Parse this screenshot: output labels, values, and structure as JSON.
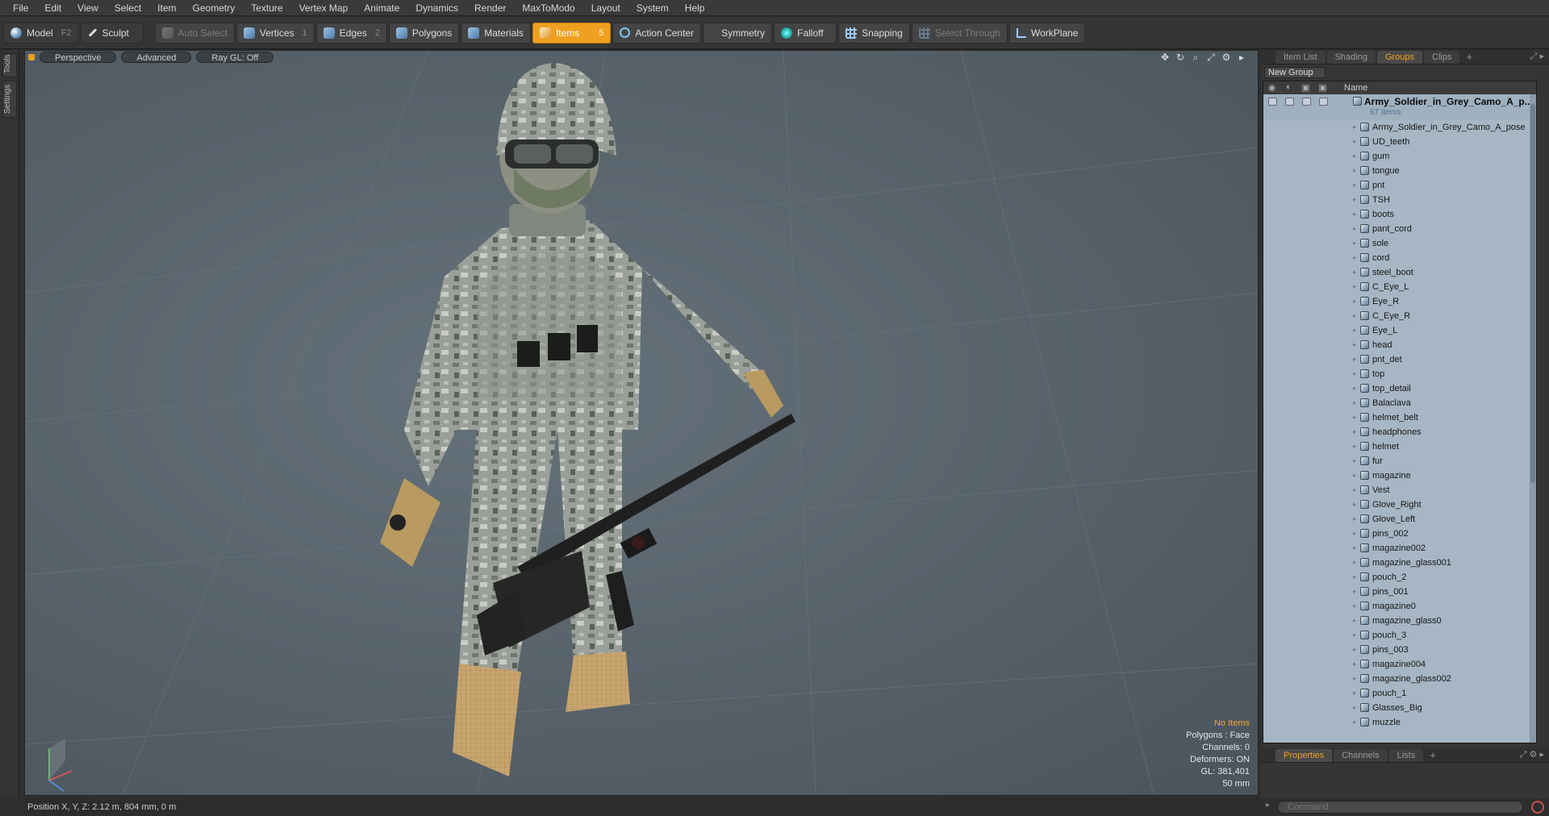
{
  "menu": [
    "File",
    "Edit",
    "View",
    "Select",
    "Item",
    "Geometry",
    "Texture",
    "Vertex Map",
    "Animate",
    "Dynamics",
    "Render",
    "MaxToModo",
    "Layout",
    "System",
    "Help"
  ],
  "toolbar": {
    "model": "Model",
    "model_key": "F2",
    "sculpt": "Sculpt",
    "auto_select": "Auto Select",
    "vertices": "Vertices",
    "vertices_key": "1",
    "edges": "Edges",
    "edges_key": "2",
    "polygons": "Polygons",
    "materials": "Materials",
    "items": "Items",
    "items_key": "5",
    "action_center": "Action Center",
    "symmetry": "Symmetry",
    "falloff": "Falloff",
    "snapping": "Snapping",
    "select_through": "Select Through",
    "workplane": "WorkPlane"
  },
  "left_tabs": [
    "Tools",
    "Settings"
  ],
  "viewport": {
    "perspective": "Perspective",
    "advanced": "Advanced",
    "raygl": "Ray GL: Off",
    "info": {
      "items": "No Items",
      "polygons": "Polygons : Face",
      "channels": "Channels: 0",
      "deformers": "Deformers: ON",
      "gl": "GL: 381,401",
      "lens": "50 mm"
    }
  },
  "status": {
    "position": "Position X, Y, Z:   2.12 m, 804 mm, 0 m"
  },
  "panel": {
    "tabs": [
      "Item List",
      "Shading",
      "Groups",
      "Clips"
    ],
    "active_tab": "Groups",
    "new_group": "New Group",
    "col_name": "Name",
    "root": {
      "name": "Army_Soldier_in_Grey_Camo_A_p...",
      "count": "67 Items"
    },
    "items": [
      "Army_Soldier_in_Grey_Camo_A_pose",
      "UD_teeth",
      "gum",
      "tongue",
      "pnt",
      "TSH",
      "boots",
      "pant_cord",
      "sole",
      "cord",
      "steel_boot",
      "C_Eye_L",
      "Eye_R",
      "C_Eye_R",
      "Eye_L",
      "head",
      "pnt_det",
      "top",
      "top_detail",
      "Balaclava",
      "helmet_belt",
      "headphones",
      "helmet",
      "fur",
      "magazine",
      "Vest",
      "Glove_Right",
      "Glove_Left",
      "pins_002",
      "magazine002",
      "magazine_glass001",
      "pouch_2",
      "pins_001",
      "magazine0",
      "magazine_glass0",
      "pouch_3",
      "pins_003",
      "magazine004",
      "magazine_glass002",
      "pouch_1",
      "Glasses_Big",
      "muzzle"
    ],
    "bottom_tabs": [
      "Properties",
      "Channels",
      "Lists"
    ],
    "bottom_active": "Properties",
    "command_placeholder": "Command"
  },
  "colors": {
    "accent": "#f0a020",
    "list_bg": "#a7b6c4",
    "viewport": "#5a666e"
  }
}
